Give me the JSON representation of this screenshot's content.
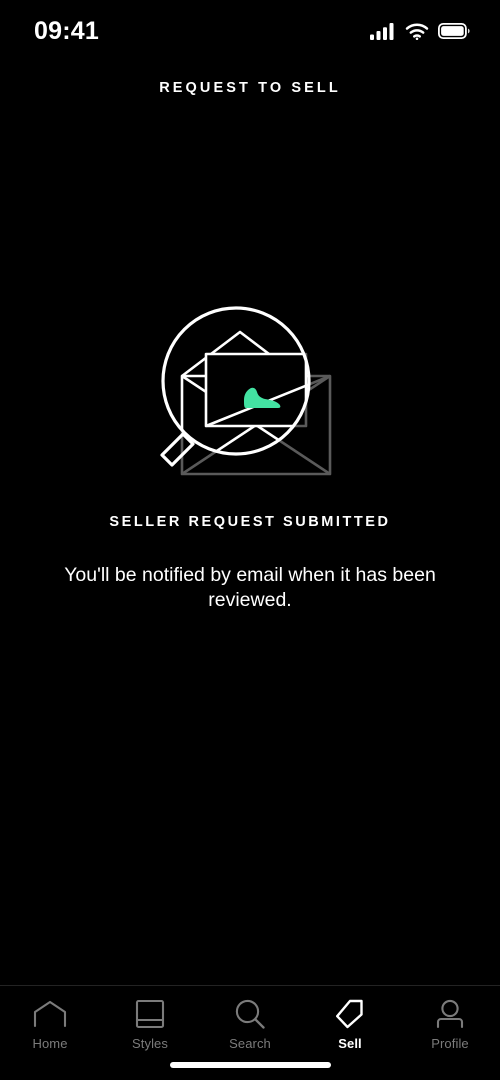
{
  "status_bar": {
    "time": "09:41",
    "icons": [
      "cellular-signal-icon",
      "wifi-icon",
      "battery-icon"
    ],
    "battery_level": 100
  },
  "header": {
    "title": "REQUEST TO SELL"
  },
  "illustration": {
    "name": "magnifier-envelope-sneaker-illustration",
    "parts": [
      "magnifying-glass-icon",
      "open-envelope-icon",
      "sneaker-icon"
    ],
    "sneaker_color": "#43E2A2",
    "line_color_bright": "#ffffff",
    "line_color_dim": "#5a5a5a"
  },
  "message": {
    "title": "SELLER REQUEST SUBMITTED",
    "body": "You'll be notified by email when it has been reviewed."
  },
  "tab_bar": {
    "active_color": "#ffffff",
    "inactive_color": "#7b7b7b",
    "items": [
      {
        "label": "Home",
        "icon": "home-icon",
        "active": false
      },
      {
        "label": "Styles",
        "icon": "styles-icon",
        "active": false
      },
      {
        "label": "Search",
        "icon": "search-icon",
        "active": false
      },
      {
        "label": "Sell",
        "icon": "tag-icon",
        "active": true
      },
      {
        "label": "Profile",
        "icon": "profile-icon",
        "active": false
      }
    ]
  },
  "home_indicator": {
    "label": "home-indicator"
  }
}
